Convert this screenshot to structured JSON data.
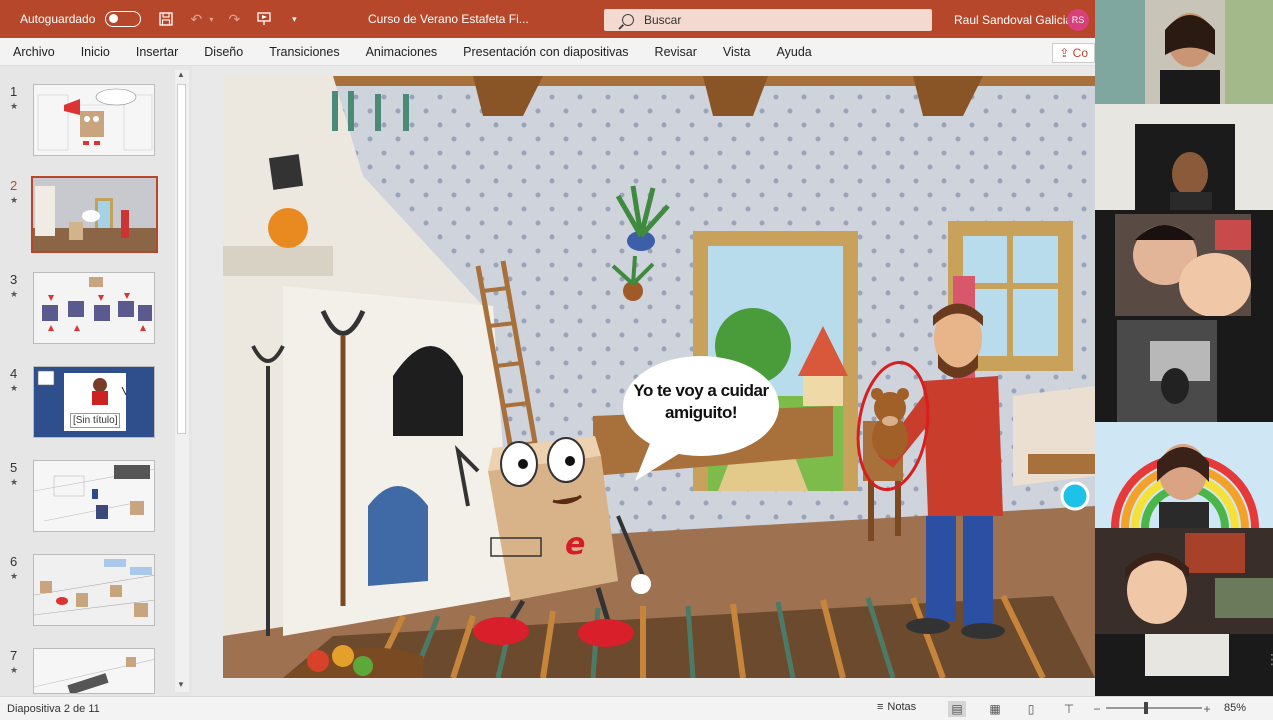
{
  "titlebar": {
    "autosave_label": "Autoguardado",
    "document_title": "Curso de Verano Estafeta Fi...",
    "search_placeholder": "Buscar",
    "user_name": "Raul Sandoval Galicia",
    "user_initials": "RS"
  },
  "ribbon": {
    "tabs": [
      "Archivo",
      "Inicio",
      "Insertar",
      "Diseño",
      "Transiciones",
      "Animaciones",
      "Presentación con diapositivas",
      "Revisar",
      "Vista",
      "Ayuda"
    ],
    "share_label": "Co"
  },
  "slides_panel": {
    "items": [
      {
        "number": "1",
        "marker": "★"
      },
      {
        "number": "2",
        "marker": "★"
      },
      {
        "number": "3",
        "marker": "★"
      },
      {
        "number": "4",
        "marker": "★",
        "thumb_label": "[Sin título]"
      },
      {
        "number": "5",
        "marker": "★"
      },
      {
        "number": "6",
        "marker": "★"
      },
      {
        "number": "7",
        "marker": "★"
      }
    ],
    "selected_index": 1
  },
  "slide": {
    "speech_bubble_text": "Yo te voy a cuidar amiguito!"
  },
  "statusbar": {
    "slide_counter": "Diapositiva 2 de 11",
    "notes_label": "Notas",
    "zoom_percent": "85%",
    "zoom_level": 0.85
  },
  "colors": {
    "accent": "#b7472a",
    "search_bg": "#f4d9d1",
    "avatar": "#d8407a"
  }
}
